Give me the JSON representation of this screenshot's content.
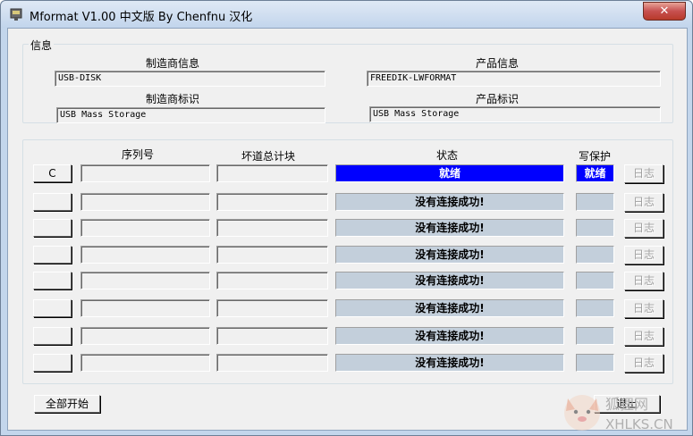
{
  "window": {
    "title": "Mformat V1.00 中文版 By Chenfnu 汉化",
    "close_glyph": "✕"
  },
  "info": {
    "legend": "信息",
    "manufacturer_info_label": "制造商信息",
    "manufacturer_info_value": "USB-DISK",
    "product_info_label": "产品信息",
    "product_info_value": "FREEDIK-LWFORMAT",
    "manufacturer_id_label": "制造商标识",
    "manufacturer_id_value": "USB Mass Storage",
    "product_id_label": "产品标识",
    "product_id_value": "USB Mass Storage"
  },
  "table": {
    "headers": {
      "serial": "序列号",
      "bad_blocks": "坏道总计块",
      "status": "状态",
      "write_protect": "写保护"
    },
    "log_label": "日志",
    "rows": [
      {
        "drive": "C",
        "serial": "",
        "bad": "",
        "status": "就绪",
        "status_kind": "ready",
        "wp": "就绪",
        "wp_kind": "ready"
      },
      {
        "drive": "",
        "serial": "",
        "bad": "",
        "status": "没有连接成功!",
        "status_kind": "fail",
        "wp": "",
        "wp_kind": "fail"
      },
      {
        "drive": "",
        "serial": "",
        "bad": "",
        "status": "没有连接成功!",
        "status_kind": "fail",
        "wp": "",
        "wp_kind": "fail"
      },
      {
        "drive": "",
        "serial": "",
        "bad": "",
        "status": "没有连接成功!",
        "status_kind": "fail",
        "wp": "",
        "wp_kind": "fail"
      },
      {
        "drive": "",
        "serial": "",
        "bad": "",
        "status": "没有连接成功!",
        "status_kind": "fail",
        "wp": "",
        "wp_kind": "fail"
      },
      {
        "drive": "",
        "serial": "",
        "bad": "",
        "status": "没有连接成功!",
        "status_kind": "fail",
        "wp": "",
        "wp_kind": "fail"
      },
      {
        "drive": "",
        "serial": "",
        "bad": "",
        "status": "没有连接成功!",
        "status_kind": "fail",
        "wp": "",
        "wp_kind": "fail"
      },
      {
        "drive": "",
        "serial": "",
        "bad": "",
        "status": "没有连接成功!",
        "status_kind": "fail",
        "wp": "",
        "wp_kind": "fail"
      }
    ]
  },
  "footer": {
    "start_all_label": "全部开始",
    "exit_label": "退出"
  },
  "watermark": {
    "text": "狐狸网",
    "url": "XHLKS.CN"
  },
  "colors": {
    "ready_bg": "#0000ff",
    "fail_bg": "#c3cfdb",
    "close_red": "#c75050"
  }
}
